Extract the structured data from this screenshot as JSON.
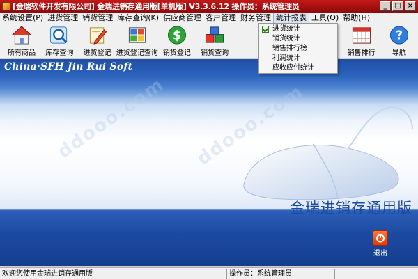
{
  "window": {
    "title": "[金瑞软件开发有限公司] 金瑞进销存通用版[单机版] V3.3.6.12 操作员：系统管理员",
    "controls": [
      "_",
      "□",
      "×"
    ]
  },
  "menubar": {
    "items": [
      {
        "label": "系统设置(P)"
      },
      {
        "label": "进货管理"
      },
      {
        "label": "销货管理"
      },
      {
        "label": "库存查询(K)"
      },
      {
        "label": "供应商管理"
      },
      {
        "label": "客户管理"
      },
      {
        "label": "财务管理"
      },
      {
        "label": "统计报表"
      },
      {
        "label": "工具(O)"
      },
      {
        "label": "帮助(H)"
      }
    ]
  },
  "toolbar": {
    "items": [
      {
        "label": "所有商品",
        "icon": "house-icon"
      },
      {
        "label": "库存查询",
        "icon": "magnifier-icon"
      },
      {
        "label": "进货登记",
        "icon": "pencil-icon"
      },
      {
        "label": "进货登记查询",
        "icon": "grid-icon"
      },
      {
        "label": "销货登记",
        "icon": "dollar-icon"
      },
      {
        "label": "销货查询",
        "icon": "boxes-icon"
      },
      {
        "label": "销售排行",
        "icon": "calendar-icon"
      },
      {
        "label": "导航",
        "icon": "help-icon"
      }
    ]
  },
  "dropdown": {
    "items": [
      {
        "label": "进货统计"
      },
      {
        "label": "销货统计"
      },
      {
        "label": "销售排行榜"
      },
      {
        "label": "利润统计"
      },
      {
        "label": "应收应付统计"
      }
    ]
  },
  "main": {
    "brand_en": "China·SFH Jin Rui Soft",
    "brand_cn": "金瑞进销存通用版",
    "exit_label": "退出"
  },
  "statusbar": {
    "welcome": "欢迎您使用金瑞进销存通用版",
    "operator": "操作员：系统管理员"
  },
  "colors": {
    "title_red": "#a81010",
    "main_blue": "#1b49a0",
    "exit_orange": "#e23a06"
  }
}
